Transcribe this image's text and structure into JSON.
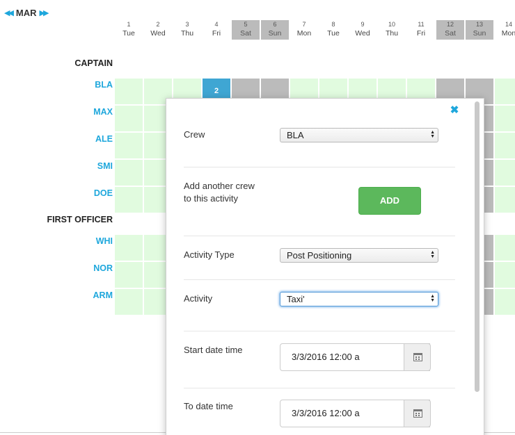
{
  "calendar": {
    "month": "MAR",
    "prev_icon": "double-chevron-left",
    "next_icon": "double-chevron-right",
    "days": [
      {
        "num": "1",
        "name": "Tue",
        "weekend": false
      },
      {
        "num": "2",
        "name": "Wed",
        "weekend": false
      },
      {
        "num": "3",
        "name": "Thu",
        "weekend": false
      },
      {
        "num": "4",
        "name": "Fri",
        "weekend": false
      },
      {
        "num": "5",
        "name": "Sat",
        "weekend": true
      },
      {
        "num": "6",
        "name": "Sun",
        "weekend": true
      },
      {
        "num": "7",
        "name": "Mon",
        "weekend": false
      },
      {
        "num": "8",
        "name": "Tue",
        "weekend": false
      },
      {
        "num": "9",
        "name": "Wed",
        "weekend": false
      },
      {
        "num": "10",
        "name": "Thu",
        "weekend": false
      },
      {
        "num": "11",
        "name": "Fri",
        "weekend": false
      },
      {
        "num": "12",
        "name": "Sat",
        "weekend": true
      },
      {
        "num": "13",
        "name": "Sun",
        "weekend": true
      },
      {
        "num": "14",
        "name": "Mon",
        "weekend": false
      }
    ],
    "sections": [
      {
        "title": "CAPTAIN",
        "crew": [
          "BLA",
          "MAX",
          "ALE",
          "SMI",
          "DOE"
        ]
      },
      {
        "title": "FIRST OFFICER",
        "crew": [
          "WHI",
          "NOR",
          "ARM"
        ]
      }
    ],
    "active_cell": {
      "crew": "BLA",
      "day": "4",
      "value": "2"
    },
    "colors": {
      "accent": "#1ea7dc",
      "available": "#e1fbdf",
      "weekend": "#bbbbbb",
      "active": "#3fa6d3",
      "add_button": "#5cb85c"
    }
  },
  "modal": {
    "close_icon": "close-x",
    "crew_label": "Crew",
    "crew_value": "BLA",
    "add_label": "Add another crew to this activity",
    "add_button": "ADD",
    "activity_type_label": "Activity Type",
    "activity_type_value": "Post Positioning",
    "activity_label": "Activity",
    "activity_value": "Taxi'",
    "start_label": "Start date time",
    "start_value": "3/3/2016 12:00 a",
    "to_label": "To date time",
    "to_value": "3/3/2016 12:00 a",
    "calendar_icon": "calendar"
  }
}
